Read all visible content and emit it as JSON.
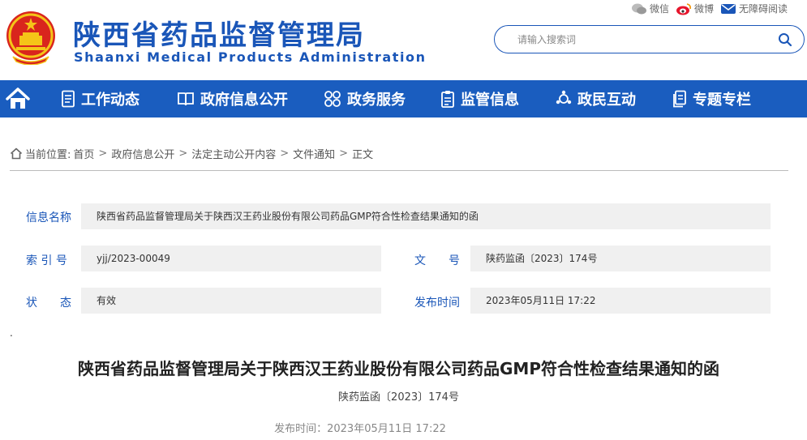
{
  "header": {
    "site_name": "陕西省药品监督管理局",
    "site_name_en": "Shaanxi Medical Products Administration",
    "top_links": {
      "wechat": "微信",
      "weibo": "微博",
      "accessibility": "无障碍阅读"
    },
    "search": {
      "placeholder": "请输入搜索词"
    }
  },
  "nav": {
    "items": [
      {
        "label": "工作动态",
        "icon": "document-list-icon"
      },
      {
        "label": "政府信息公开",
        "icon": "open-book-icon"
      },
      {
        "label": "政务服务",
        "icon": "services-grid-icon"
      },
      {
        "label": "监管信息",
        "icon": "clipboard-icon"
      },
      {
        "label": "政民互动",
        "icon": "interaction-icon"
      },
      {
        "label": "专题专栏",
        "icon": "file-copy-icon"
      }
    ]
  },
  "breadcrumb": {
    "prefix": "当前位置:",
    "items": [
      "首页",
      "政府信息公开",
      "法定主动公开内容",
      "文件通知",
      "正文"
    ]
  },
  "info": {
    "name_label": "信息名称",
    "name_value": "陕西省药品监督管理局关于陕西汉王药业股份有限公司药品GMP符合性检查结果通知的函",
    "index_label": "索 引 号",
    "index_value": "yjj/2023-00049",
    "docno_label": "文　　号",
    "docno_value": "陕药监函〔2023〕174号",
    "status_label": "状　　态",
    "status_value": "有效",
    "pubtime_label": "发布时间",
    "pubtime_value": "2023年05月11日 17:22"
  },
  "article": {
    "dot": ".",
    "title": "陕西省药品监督管理局关于陕西汉王药业股份有限公司药品GMP符合性检查结果通知的函",
    "doc_no": "陕药监函〔2023〕174号",
    "pub_time": "发布时间：2023年05月11日 17:22"
  },
  "colors": {
    "brand_blue": "#1a56b8",
    "nav_blue": "#1a5dbf",
    "value_bg": "#f0f0f0"
  }
}
